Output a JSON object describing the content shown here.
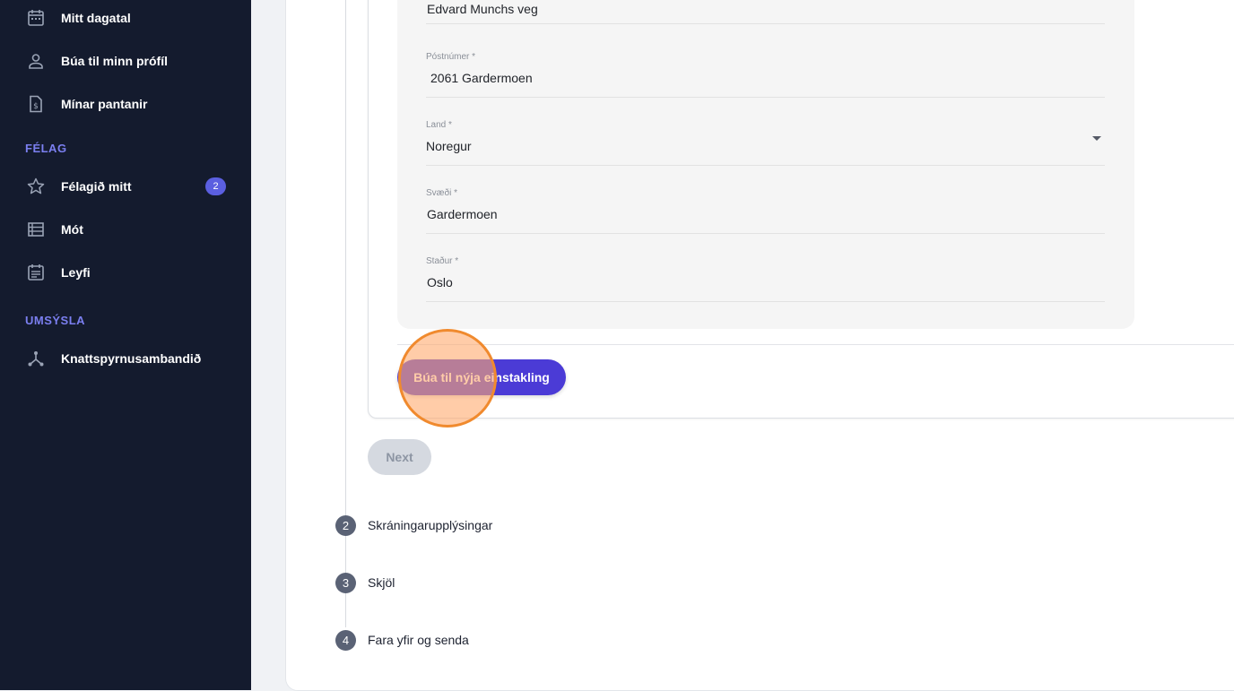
{
  "sidebar": {
    "items_top": [
      {
        "label": "Mitt dagatal",
        "icon": "calendar-icon"
      },
      {
        "label": "Búa til minn prófíl",
        "icon": "person-icon"
      },
      {
        "label": "Mínar pantanir",
        "icon": "invoice-icon"
      }
    ],
    "section_felag": "FÉLAG",
    "items_felag": [
      {
        "label": "Félagið mitt",
        "icon": "star-icon",
        "badge": "2"
      },
      {
        "label": "Mót",
        "icon": "list-icon"
      },
      {
        "label": "Leyfi",
        "icon": "license-icon"
      }
    ],
    "section_umsysla": "UMSÝSLA",
    "items_umsysla": [
      {
        "label": "Knattspyrnusambandið",
        "icon": "network-icon"
      }
    ]
  },
  "form": {
    "address": {
      "value": "Edvard Munchs veg"
    },
    "postal": {
      "label": "Póstnúmer *",
      "value": "2061 Gardermoen"
    },
    "country": {
      "label": "Land *",
      "value": "Noregur"
    },
    "region": {
      "label": "Svæði *",
      "value": "Gardermoen"
    },
    "city": {
      "label": "Staður *",
      "value": "Oslo"
    }
  },
  "buttons": {
    "create": "Búa til nýja einstakling",
    "next": "Next"
  },
  "steps": [
    {
      "num": "2",
      "label": "Skráningarupplýsingar"
    },
    {
      "num": "3",
      "label": "Skjöl"
    },
    {
      "num": "4",
      "label": "Fara yfir og senda"
    }
  ]
}
